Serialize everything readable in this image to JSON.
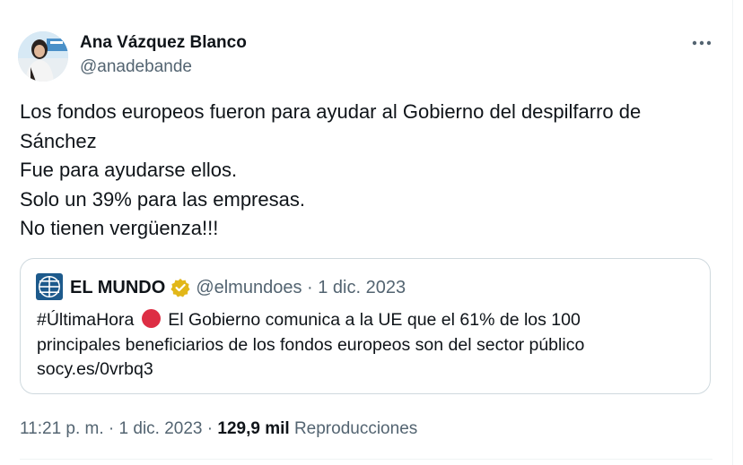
{
  "author": {
    "name": "Ana Vázquez Blanco",
    "handle": "@anadebande"
  },
  "tweet": {
    "lines": [
      "Los fondos europeos fueron para ayudar al Gobierno del despilfarro de",
      "Sánchez",
      "Fue para ayudarse ellos.",
      "Solo un 39% para las empresas.",
      "No tienen vergüenza!!!"
    ]
  },
  "quote": {
    "name": "EL MUNDO",
    "handle_date": "@elmundoes · 1 dic. 2023",
    "hashtag": "#ÚltimaHora",
    "line1_rest": "El Gobierno comunica a la UE que el 61% de los 100",
    "line2": "principales beneficiarios de los fondos europeos son del sector público",
    "link": "socy.es/0vrbq3"
  },
  "meta": {
    "timestamp": "11:21 p. m. · 1 dic. 2023 ·",
    "views_count": "129,9 mil",
    "views_label": "Reproducciones"
  },
  "icons": {
    "more": "more-icon",
    "verified": "verified-badge-icon",
    "logo": "elmundo-logo",
    "red_circle": "red-circle-icon"
  },
  "colors": {
    "text": "#0f1419",
    "secondary": "#536471",
    "border": "#cfd9de",
    "verified_gold": "#e2b719",
    "red_circle": "#dd2e44"
  }
}
